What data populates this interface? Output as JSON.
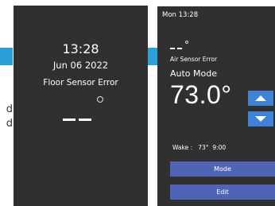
{
  "left_panel": {
    "time": "13:28",
    "date": "Jun 06 2022",
    "error": "Floor Sensor Error",
    "clipped_text_1": "d",
    "clipped_text_2": "d"
  },
  "right_panel": {
    "header": "Mon 13:28",
    "error": "Air Sensor Error",
    "mode": "Auto Mode",
    "temperature": "73.0°",
    "wake_line": "Wake :   73°  9:00",
    "mode_button": "Mode",
    "edit_button": "Edit"
  },
  "colors": {
    "screen_bg": "#303030",
    "accent_blue": "#2a9fd8",
    "arrow_button": "#3f82d6",
    "action_button": "#5064b6"
  },
  "icons": {
    "up": "arrow-up-icon",
    "down": "arrow-down-icon"
  }
}
